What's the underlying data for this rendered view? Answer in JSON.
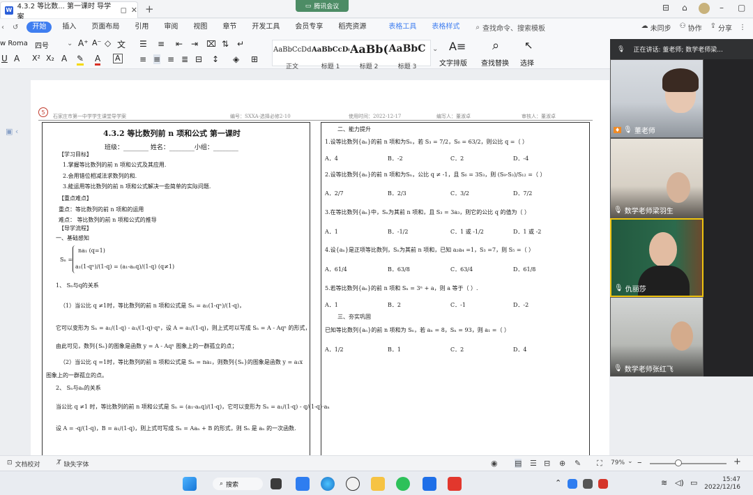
{
  "titlebar": {
    "doc_tab_title": "4.3.2 等比数... 第一课时 导学案",
    "meeting_label": "腾讯会议",
    "win_controls": [
      "⊟",
      "⌂",
      "–",
      "▢"
    ]
  },
  "menu": {
    "items": [
      "开始",
      "插入",
      "页面布局",
      "引用",
      "审阅",
      "视图",
      "章节",
      "开发工具",
      "会员专享",
      "稻壳资源",
      "表格工具",
      "表格样式"
    ],
    "search": "查找命令、搜索模板",
    "right": [
      "未同步",
      "协作",
      "分享"
    ]
  },
  "ribbon": {
    "font_name": "w Roma",
    "font_size": "四号",
    "styles": [
      {
        "preview": "AaBbCcDd",
        "caption": "正文"
      },
      {
        "preview": "AaBbCcDd",
        "caption": "标题 1"
      },
      {
        "preview": "AaBb(",
        "caption": "标题 2"
      },
      {
        "preview": "AaBbC",
        "caption": "标题 3"
      }
    ],
    "tools": [
      "文字排版",
      "查找替换",
      "选择"
    ]
  },
  "doc": {
    "header_school": "石家庄市第一中学学生课堂导学案",
    "header_code": "编号：SXXA-选择必修2-10",
    "header_date": "使用时间：2022-12-17",
    "header_author": "编写人：董淑卓",
    "header_reviewer": "审核人：董淑卓",
    "page_marker": "5",
    "left": {
      "title": "4.3.2 等比数列前 n 项和公式 第一课时",
      "class_line": "班级：________ 姓名：________小组：________",
      "goals_heading": "【学习目标】",
      "goals": [
        "1.掌握等比数列的前 n 项和公式及其应用.",
        "2.会用错位相减法求数列的和.",
        "3.能运用等比数列的前 n 项和公式解决一些简单的实际问题."
      ],
      "key_heading": "【重点难点】",
      "key_point": "重点：等比数列的前 n 项和的运用",
      "hard_point": "难点：  等比数列的前 n 项和公式的推导",
      "guide_heading": "【导学流程】",
      "basics": "一、基础感知",
      "formula_case1": "na₁                (q=1)",
      "formula_case2": "a₁(1-qⁿ)/(1-q) = (a₁-aₙq)/(1-q)    (q≠1)",
      "formula_lhs": "Sₙ =",
      "rel1_heading": "1、 Sₙ与q的关系",
      "rel1_p1": "（1）当公比 q ≠1时，等比数列的前 n 项和公式是 Sₙ = a₁(1-qⁿ)/(1-q)，",
      "rel1_p2": "它可以变形为 Sₙ = a₁/(1-q) - a₁/(1-q)·qⁿ，设 A = a₁/(1-q)，则上式可以写成 Sₙ = A - Aqⁿ 的形式，",
      "rel1_p3": "由此可见，数列{Sₙ}的图象是函数 y = A - Aqˣ 图象上的一群孤立的点；",
      "rel1_p4": "（2）当公比 q =1时，等比数列的前 n 项和公式是 Sₙ = na₁，则数列{Sₙ}的图象是函数 y = a₁x",
      "rel1_p5": "图象上的一群孤立的点。",
      "rel2_heading": "2、 Sₙ与aₙ的关系",
      "rel2_p1": "当公比 q ≠1 时，等比数列的前 n 项和公式是 Sₙ = (a₁-aₙq)/(1-q)，它可以变形为 Sₙ = a₁/(1-q) - q/(1-q)·aₙ",
      "rel2_p2": "设 A = -q/(1-q)，B = a₁/(1-q)，则上式可写成 Sₙ = Aaₙ + B 的形式，则 Sₙ 是 aₙ 的一次函数."
    },
    "right": {
      "section2": "二、能力提升",
      "q1": "1.设等比数列{aₙ}的前 n 项和为Sₙ，若 S₃ = 7/2，S₆ = 63/2，则公比 q =（    ）",
      "q1_opts": [
        "A．4",
        "B．-2",
        "C．2",
        "D．-4"
      ],
      "q2": "2.设等比数列{aₙ}的前 n 项和为Sₙ，公比 q ≠ -1，且 S₆ = 3S₃，则 (S₉-S₃)/S₁₂ =（    ）",
      "q2_opts": [
        "A．2/7",
        "B．2/3",
        "C．3/2",
        "D．7/2"
      ],
      "q3": "3.在等比数列{aₙ}中，Sₙ为其前 n 项和，且 S₃ = 3a₃，则它的公比 q 的值为（    ）",
      "q3_opts": [
        "A．1",
        "B．-1/2",
        "C．1 或 -1/2",
        "D．1 或 -2"
      ],
      "q4": "4.设{aₙ}是正项等比数列，Sₙ为其前 n 项和，已知 a₂a₄ =1，S₃ =7，则 S₅ =（    ）",
      "q4_opts": [
        "A．61/4",
        "B．63/8",
        "C．63/4",
        "D．61/8"
      ],
      "q5": "5.若等比数列{aₙ}的前 n 项和 Sₙ = 3ⁿ + a，则 a 等于（    ）.",
      "q5_opts": [
        "A．1",
        "B．2",
        "C．-1",
        "D．-2"
      ],
      "section3": "三、夯实巩固",
      "q6": "已知等比数列{aₙ}的前 n 项和为 Sₙ，若 aₙ = 8，Sₙ = 93，则 a₁ =（    ）",
      "q6_opts": [
        "A．1/2",
        "B．1",
        "C．2",
        "D．4"
      ]
    }
  },
  "video": {
    "speaking_label": "正在讲话: 董老师; 数学老师梁...",
    "participants": [
      "董老师",
      "数学老师梁羽生",
      "仇丽莎",
      "数学老师张红飞"
    ]
  },
  "statusbar": {
    "proofread": "文档校对",
    "missing_font": "缺失字体",
    "zoom": "79%"
  },
  "taskbar": {
    "search_label": "搜索",
    "time": "15:47",
    "date": "2022/12/16"
  },
  "colors": {
    "accent": "#3f7ef0",
    "meeting_green": "#4d8c65",
    "page_marker_red": "#c0392b"
  }
}
